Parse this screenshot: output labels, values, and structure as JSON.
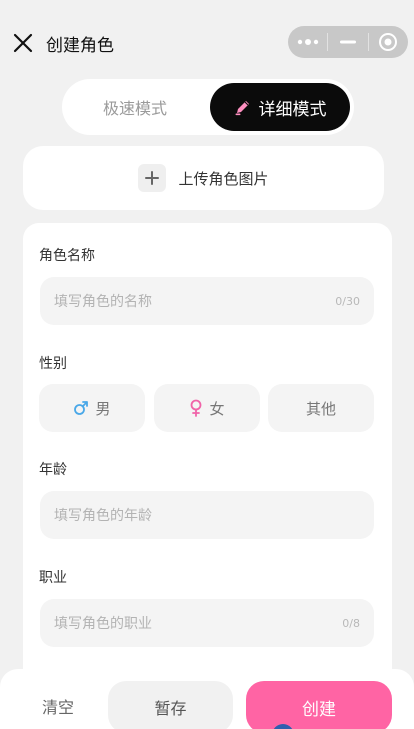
{
  "header": {
    "title": "创建角色",
    "close_icon": "close-icon",
    "capsule_icons": [
      "more-dots-icon",
      "minimize-icon",
      "target-icon"
    ]
  },
  "mode_switch": {
    "fast_label": "极速模式",
    "detail_label": "详细模式",
    "active": "detail",
    "active_icon": "pencil-icon"
  },
  "upload": {
    "label": "上传角色图片",
    "icon": "plus-icon"
  },
  "form": {
    "name": {
      "label": "角色名称",
      "placeholder": "填写角色的名称",
      "value": "",
      "counter": "0/30"
    },
    "gender": {
      "label": "性别",
      "options": [
        {
          "label": "男",
          "icon": "male-icon",
          "color": "#4aa8e8"
        },
        {
          "label": "女",
          "icon": "female-icon",
          "color": "#f063a8"
        },
        {
          "label": "其他",
          "icon": "",
          "color": ""
        }
      ]
    },
    "age": {
      "label": "年龄",
      "placeholder": "填写角色的年龄",
      "value": ""
    },
    "job": {
      "label": "职业",
      "placeholder": "填写角色的职业",
      "value": "",
      "counter": "0/8"
    }
  },
  "bottom": {
    "clear_label": "清空",
    "draft_label": "暂存",
    "create_label": "创建"
  },
  "colors": {
    "accent": "#ff64a4",
    "background": "#f1f1f1",
    "active_tab": "#0b0b0b"
  }
}
